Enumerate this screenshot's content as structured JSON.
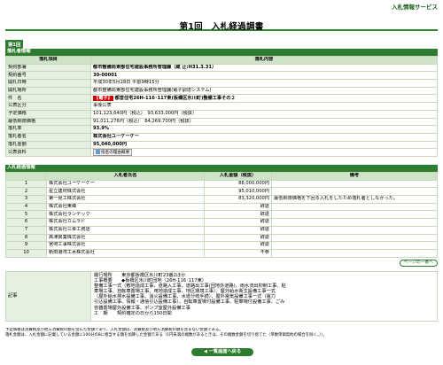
{
  "header": {
    "service_label": "入札情報サービス",
    "title": "第1回　入札経過調書"
  },
  "tab_label": "第1回",
  "info_section": {
    "section_title": "落札者情報",
    "col_item": "落札項目",
    "col_content": "落札内容",
    "rows": [
      {
        "label": "契約部署",
        "value": "都市整備局東部住宅建設事務所管理課（蔵 止:H31.3.31）",
        "bold": true
      },
      {
        "label": "契約番号",
        "value": "30-00001",
        "bold": true
      },
      {
        "label": "開札日時",
        "value": "平成30年5月28日 午前9時15分",
        "bold": false
      },
      {
        "label": "開札場所",
        "value": "都市整備局東部住宅建設事務所管理課(電子調達システム)",
        "bold": false
      },
      {
        "label": "件　名",
        "tag": "【電子】",
        "value": "都営住宅26H-116･117東(板橋区氷川町)整備工事その２",
        "bold": true
      },
      {
        "label": "公表区分",
        "value": "事後公表",
        "bold": false
      },
      {
        "label": "予定価格",
        "value": "101,123,640円（税込）　93,633,000円（税抜）",
        "bold": false
      },
      {
        "label": "最低制限価格",
        "value": "91,011,276円（税込）　84,269,700円（税抜）",
        "bold": false
      },
      {
        "label": "落札率",
        "value": "93.9%",
        "bold": true
      },
      {
        "label": "落札者名",
        "value": "株式会社ユーケーケー",
        "bold": true
      },
      {
        "label": "落札金額",
        "value": "95,040,000円",
        "bold": true
      },
      {
        "label": "公表資料",
        "button": "指名の理由概要",
        "bold": false
      }
    ]
  },
  "bid_section": {
    "section_title": "入札経過情報",
    "col_name": "入札者氏名",
    "col_amount": "入札金額（税抜）",
    "col_remarks": "備考",
    "rows": [
      {
        "no": "1",
        "name": "株式会社ユーケーケー",
        "amount": "88,000,000円",
        "remarks": ""
      },
      {
        "no": "2",
        "name": "星立建材株式会社",
        "amount": "95,010,000円",
        "remarks": ""
      },
      {
        "no": "3",
        "name": "第一晃工株式会社",
        "amount": "83,320,000円",
        "remarks": "最低制限価格を下回る入札をしたため落札者としなかった。"
      },
      {
        "no": "4",
        "name": "株式会社東峰",
        "amount": "辞退",
        "remarks": ""
      },
      {
        "no": "5",
        "name": "株式会社ランテック",
        "amount": "辞退",
        "remarks": ""
      },
      {
        "no": "6",
        "name": "株式会社カムラド",
        "amount": "辞退",
        "remarks": ""
      },
      {
        "no": "7",
        "name": "株式会社三幸工務店",
        "amount": "辞退",
        "remarks": ""
      },
      {
        "no": "8",
        "name": "高津興業株式会社",
        "amount": "辞退",
        "remarks": ""
      },
      {
        "no": "9",
        "name": "宮﨑工事株式会社",
        "amount": "辞退",
        "remarks": ""
      },
      {
        "no": "10",
        "name": "新田港湾工木株式会社",
        "amount": "不参",
        "remarks": ""
      }
    ],
    "page_top_label": "ページの一番へ"
  },
  "kiji": {
    "label": "記事",
    "lines": [
      "履行場所　　東京都板橋区氷川町23番2ほか",
      "工事概要　　◆板橋区氷川町団地（26H-116･117東）",
      "整備工事一式（敷地造成工事、道路入工事、道路出工事(団地外道路)、雨水流出抑制工事、駐",
      "車場工事、自転車置場工事、用地造成工事、地区環境工事）、屋外給水衛生設備工事一式",
      "（屋外給水排水設備工事、消火設備工事、水道分岐手続）、屋外電気設備工事一式（電力",
      "引込設備工事、情報・通信引込設備工事）、自転車置場付設備工事、駐車場付設備工事、ごみ",
      "容器置場屋外設備工事、ポンプ室屋外設備工事",
      "工　期　　契約確定の日から150日間"
    ]
  },
  "notes": [
    "予定価格は消費税及び地方消費税の額を含んだ金額であり、入札金額は、消費税及び地方消費税の額を含まない金額である。",
    "落札金額は、入札金額に記載している金額に100分の8に相当する額を加算した金額である（1円未満の端数があるときは、その端数金額を切り捨てた（単数単価契約の場合を除く。））。"
  ],
  "back_button": "◀ 一覧画面へ戻る"
}
